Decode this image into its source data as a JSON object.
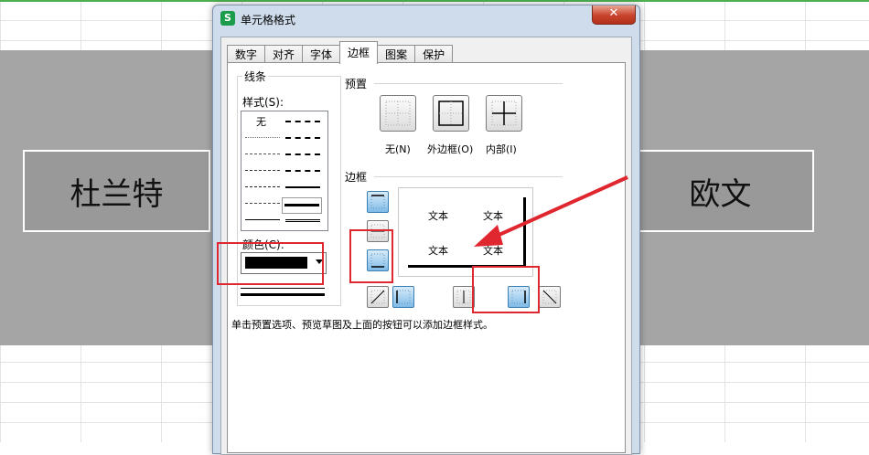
{
  "sheet": {
    "left_cell_text": "杜兰特",
    "right_cell_text": "欧文"
  },
  "dialog": {
    "app_icon": "S",
    "title": "单元格格式",
    "close_label": "✕",
    "tabs": [
      "数字",
      "对齐",
      "字体",
      "边框",
      "图案",
      "保护"
    ],
    "active_tab": "边框",
    "line_group": {
      "label": "线条",
      "style_label": "样式(S):",
      "none_label": "无",
      "color_label": "颜色(C):",
      "color_value": "#000000"
    },
    "preset_group": {
      "label": "预置",
      "buttons": [
        "无(N)",
        "外边框(O)",
        "内部(I)"
      ]
    },
    "border_group": {
      "label": "边框",
      "preview_text": [
        "文本",
        "文本",
        "文本",
        "文本"
      ]
    },
    "hint": "单击预置选项、预览草图及上面的按钮可以添加边框样式。"
  },
  "annotations": {
    "highlight_color": "#e0262e"
  }
}
